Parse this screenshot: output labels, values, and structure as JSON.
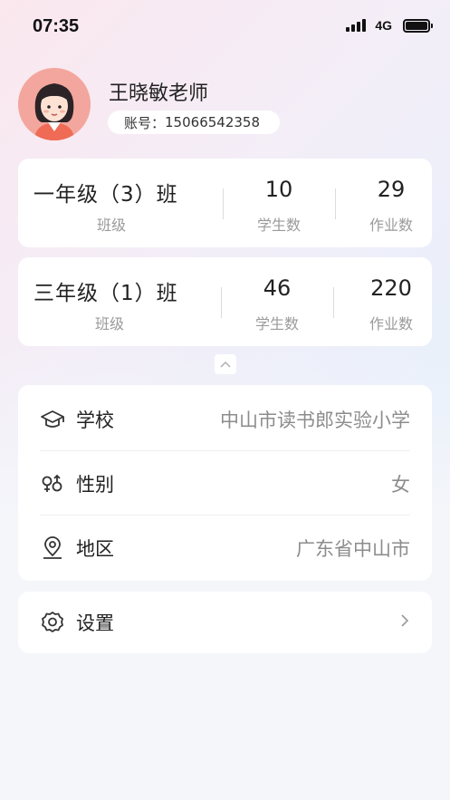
{
  "status_bar": {
    "time": "07:35",
    "network": "4G"
  },
  "profile": {
    "name": "王晓敏老师",
    "account_label": "账号：",
    "account_number": "15066542358"
  },
  "classes": [
    {
      "name": "一年级（3）班",
      "name_label": "班级",
      "students": "10",
      "students_label": "学生数",
      "homework": "29",
      "homework_label": "作业数"
    },
    {
      "name": "三年级（1）班",
      "name_label": "班级",
      "students": "46",
      "students_label": "学生数",
      "homework": "220",
      "homework_label": "作业数"
    }
  ],
  "info": {
    "school": {
      "label": "学校",
      "value": "中山市读书郎实验小学",
      "icon": "graduation-cap-icon"
    },
    "gender": {
      "label": "性别",
      "value": "女",
      "icon": "gender-icon"
    },
    "region": {
      "label": "地区",
      "value": "广东省中山市",
      "icon": "location-pin-icon"
    }
  },
  "settings": {
    "label": "设置",
    "icon": "gear-icon"
  },
  "colors": {
    "avatar_bg": "#f3a69d",
    "card_bg": "#ffffff",
    "muted_text": "#9a9a9a"
  }
}
